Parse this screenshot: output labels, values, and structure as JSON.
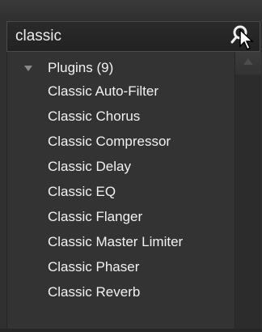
{
  "search": {
    "value": "classic"
  },
  "icons": {
    "search": "magnifier-icon",
    "cursor": "mouse-pointer-icon",
    "expand": "triangle-down-icon",
    "scroll": "triangle-up-icon"
  },
  "group": {
    "label": "Plugins (9)"
  },
  "items": [
    "Classic Auto-Filter",
    "Classic Chorus",
    "Classic Compressor",
    "Classic Delay",
    "Classic EQ",
    "Classic Flanger",
    "Classic Master Limiter",
    "Classic Phaser",
    "Classic Reverb"
  ]
}
